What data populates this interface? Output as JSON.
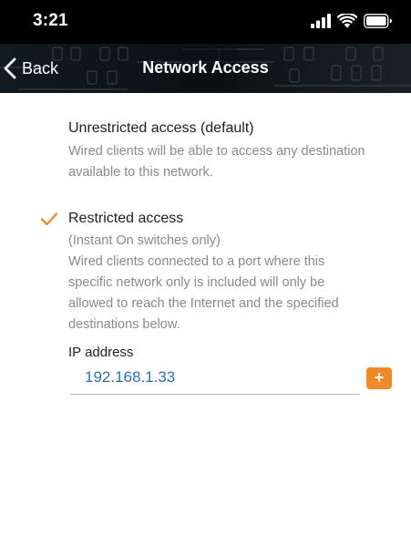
{
  "status_bar": {
    "time": "3:21",
    "icons": [
      "signal-icon",
      "wifi-icon",
      "battery-icon"
    ]
  },
  "nav": {
    "back_label": "Back",
    "title": "Network Access",
    "icon": "chevron-left-icon"
  },
  "options": [
    {
      "title": "Unrestricted access (default)",
      "desc_lines": [
        "Wired clients will be able to access any destination",
        "available to this network."
      ],
      "selected": false
    },
    {
      "title": "Restricted access",
      "desc_lines": [
        "(Instant On switches only)",
        "Wired clients connected to a port where this",
        "specific network only is included will only be",
        "allowed to reach the Internet and the specified",
        "destinations below."
      ],
      "selected": true
    }
  ],
  "ip_field": {
    "label": "IP address",
    "value": "192.168.1.33",
    "add_label": "+"
  },
  "colors": {
    "accent": "#ef8a2a",
    "input_text": "#2f6fb0",
    "muted_text": "#8a8a8a"
  }
}
